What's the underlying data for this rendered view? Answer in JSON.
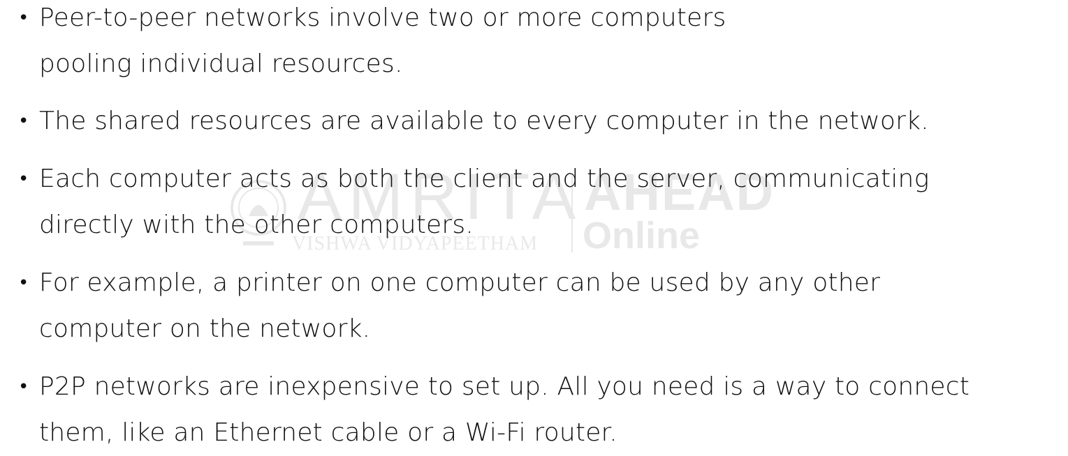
{
  "bullets": [
    "Peer-to-peer networks involve two or more computers\npooling individual resources.",
    "The shared resources are available to every computer in the network.",
    "Each computer acts as both the client and the server, communicating\ndirectly with the other computers.",
    "For example, a printer on one computer can be used by any other\ncomputer on the network.",
    "P2P networks are inexpensive to set up. All you need is a way to connect\nthem, like an Ethernet cable or a Wi-Fi router."
  ],
  "bullet_symbol": "•",
  "watermark": {
    "main": "AMRITA",
    "sub": "VISHWA VIDYAPEETHAM",
    "brand": "AHEAD",
    "brand_sub": "Online"
  }
}
